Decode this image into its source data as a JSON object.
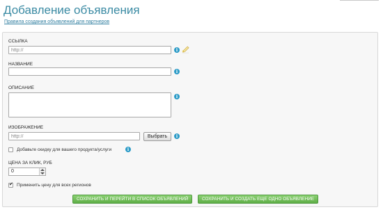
{
  "page": {
    "title": "Добавление объявления",
    "rules_link": "Правила создания объявлений для партнеров"
  },
  "form": {
    "link": {
      "label": "ССЫЛКА",
      "placeholder": "http://"
    },
    "name": {
      "label": "НАЗВАНИЕ",
      "value": ""
    },
    "description": {
      "label": "ОПИСАНИЕ",
      "value": ""
    },
    "image": {
      "label": "ИЗОБРАЖЕНИЕ",
      "placeholder": "http://",
      "button": "Выбрать"
    },
    "discount": {
      "label": "Добавьте скидку для вашего продукта/услуги",
      "checked": false
    },
    "price": {
      "label": "ЦЕНА ЗА КЛИК, РУБ",
      "value": "0"
    },
    "all_regions": {
      "label": "Применить цену для всех регионов",
      "checked": true
    }
  },
  "actions": {
    "save_list": "СОХРАНИТЬ И ПЕРЕЙТИ В СПИСОК ОБЪЯВЛЕНИЙ",
    "save_new": "СОХРАНИТЬ И СОЗДАТЬ ЕЩЕ ОДНО ОБЪЯВЛЕНИЕ"
  },
  "colors": {
    "title": "#3a8aa3",
    "info_icon": "#2b9bc7",
    "button_green": "#6ab851"
  },
  "icons": [
    "info-icon",
    "pencil-icon",
    "check-icon"
  ]
}
